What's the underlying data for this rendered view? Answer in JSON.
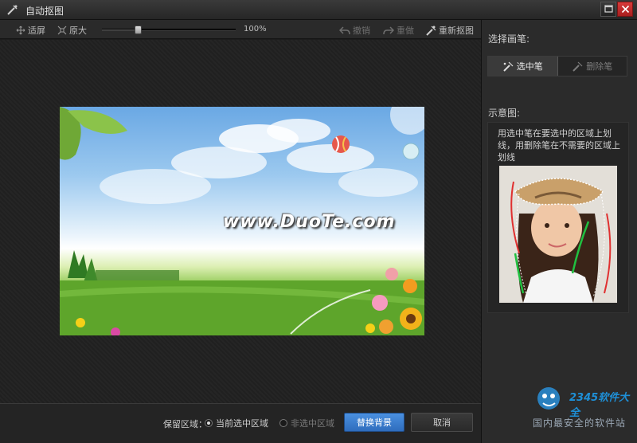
{
  "window": {
    "title": "自动抠图"
  },
  "toolbar": {
    "fit_label": "适屏",
    "original_label": "原大",
    "zoom_level": "100%",
    "zoom_fraction": 0.27,
    "undo_label": "撤销",
    "redo_label": "重做",
    "recut_label": "重新抠图"
  },
  "canvas": {
    "watermark": "www.DuoTe.com"
  },
  "bottom": {
    "keep_area_label": "保留区域：",
    "option_selected_label": "当前选中区域",
    "option_unselected_label": "非选中区域",
    "replace_bg_label": "替换背景",
    "cancel_label": "取消"
  },
  "panel": {
    "choose_brush_heading": "选择画笔:",
    "select_brush_label": "选中笔",
    "erase_brush_label": "删除笔",
    "example_heading": "示意图:",
    "hint_text": "用选中笔在要选中的区域上划线，用删除笔在不需要的区域上划线"
  },
  "branding": {
    "logo_text": "2345软件大全",
    "slogan": "国内最安全的软件站"
  },
  "colors": {
    "accent": "#2f6dbd",
    "close": "#c62a2a",
    "background": "#1c1c1c"
  },
  "icons": [
    "app-icon",
    "maximize-icon",
    "close-icon",
    "fit-screen-icon",
    "original-size-icon",
    "undo-icon",
    "redo-icon",
    "recut-icon",
    "select-brush-icon",
    "erase-brush-icon"
  ]
}
